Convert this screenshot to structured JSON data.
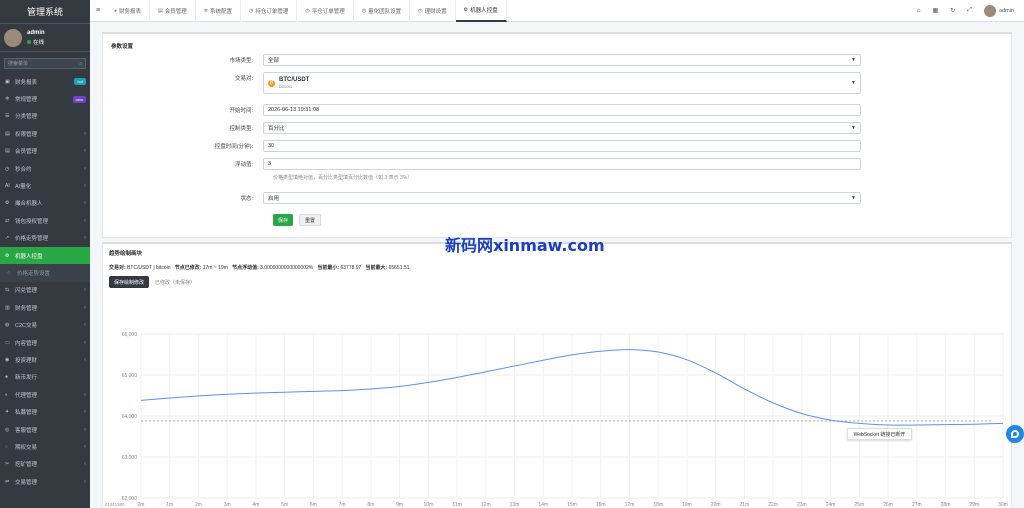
{
  "sidebar": {
    "brand": "管理系统",
    "user": {
      "name": "admin",
      "status": "在线"
    },
    "search_placeholder": "搜索菜单",
    "items": [
      {
        "label": "财务报表",
        "icon": "chart-icon",
        "badge": "hot"
      },
      {
        "label": "常规管理",
        "icon": "gear-icon",
        "badge": "new"
      },
      {
        "label": "分类管理",
        "icon": "list-icon"
      },
      {
        "label": "权限管理",
        "icon": "group-icon",
        "arrow": true
      },
      {
        "label": "会员管理",
        "icon": "user-icon",
        "arrow": true
      },
      {
        "label": "秒合约",
        "icon": "clock-icon",
        "arrow": true
      },
      {
        "label": "AI量化",
        "icon": "ai-icon",
        "arrow": true
      },
      {
        "label": "撮合机器人",
        "icon": "robot-icon",
        "arrow": true
      },
      {
        "label": "钱包授权管理",
        "icon": "transfer-icon",
        "arrow": true
      },
      {
        "label": "价格走势管理",
        "icon": "trend-icon",
        "arrow": true
      },
      {
        "label": "机器人控盘",
        "icon": "robot-icon",
        "active": true
      },
      {
        "label": "价格走势设置",
        "icon": "dot-icon",
        "sub": true
      },
      {
        "label": "闪兑管理",
        "icon": "exchange-icon",
        "arrow": true
      },
      {
        "label": "财务管理",
        "icon": "money-icon",
        "arrow": true
      },
      {
        "label": "C2C交易",
        "icon": "c2c-icon",
        "arrow": true
      },
      {
        "label": "内容管理",
        "icon": "folder-icon",
        "arrow": true
      },
      {
        "label": "投资理财",
        "icon": "invest-icon",
        "arrow": true
      },
      {
        "label": "新币发行",
        "icon": "coin-icon"
      },
      {
        "label": "代理管理",
        "icon": "agent-icon",
        "arrow": true
      },
      {
        "label": "私募管理",
        "icon": "private-icon",
        "arrow": true
      },
      {
        "label": "客服管理",
        "icon": "chat-icon",
        "arrow": true
      },
      {
        "label": "期权交易",
        "icon": "option-icon",
        "arrow": true
      },
      {
        "label": "挖矿管理",
        "icon": "mining-icon",
        "arrow": true
      },
      {
        "label": "交易管理",
        "icon": "trade-icon",
        "arrow": true
      }
    ]
  },
  "topbar": {
    "tabs": [
      {
        "label": "财务报表",
        "icon": "dashboard-icon"
      },
      {
        "label": "会员管理",
        "icon": "user-icon"
      },
      {
        "label": "系统配置",
        "icon": "gear-icon"
      },
      {
        "label": "持仓订单管理",
        "icon": "clock-icon"
      },
      {
        "label": "平仓订单管理",
        "icon": "clock-icon"
      },
      {
        "label": "量化团队设置",
        "icon": "clock-icon"
      },
      {
        "label": "理财设置",
        "icon": "clock-icon"
      },
      {
        "label": "机器人控盘",
        "icon": "robot-icon",
        "active": true
      }
    ],
    "admin": "admin"
  },
  "form": {
    "title": "参数设置",
    "market_type": {
      "label": "市场类型:",
      "value": "全部"
    },
    "pair": {
      "label": "交易对:",
      "title": "BTC/USDT",
      "sub": "bitcoin"
    },
    "start_time": {
      "label": "开始时间:",
      "value": "2026-06-13 19:31:08"
    },
    "control_type": {
      "label": "控制类型:",
      "value": "百分比"
    },
    "duration": {
      "label": "控盘时间(分钟):",
      "value": "30"
    },
    "float_value": {
      "label": "浮动值:",
      "value": "3",
      "help": "价格类型填绝对值，百分比类型填百分比数值（如 3 表示 3%）"
    },
    "status": {
      "label": "状态:",
      "value": "启用"
    },
    "save_label": "保存",
    "reset_label": "重置"
  },
  "trend": {
    "title": "趋势绘制画块",
    "info": {
      "pair_label": "交易对:",
      "pair_value": "BTC/USDT | bitcoin",
      "node_label": "节点已修改:",
      "node_value": "17m ~ 19m",
      "float_label": "节点浮动值:",
      "float_value": "3.0000000000000002%",
      "min_label": "当前最小:",
      "min_value": "63778.97",
      "max_label": "当前最大:",
      "max_value": "65651.51"
    },
    "save_button": "保存绘制修改",
    "save_note": "已修改（未保存）"
  },
  "chart_data": {
    "type": "line",
    "x": [
      "0m",
      "1m",
      "2m",
      "3m",
      "4m",
      "5m",
      "6m",
      "7m",
      "8m",
      "9m",
      "10m",
      "11m",
      "12m",
      "13m",
      "14m",
      "15m",
      "16m",
      "17m",
      "18m",
      "19m",
      "20m",
      "21m",
      "22m",
      "23m",
      "24m",
      "25m",
      "26m",
      "27m",
      "28m",
      "29m",
      "30m"
    ],
    "series": [
      {
        "values": [
          64380,
          64440,
          64490,
          64530,
          64560,
          64580,
          64600,
          64620,
          64660,
          64720,
          64820,
          64940,
          65080,
          65220,
          65360,
          65490,
          65580,
          65620,
          65560,
          65370,
          65050,
          64660,
          64320,
          64060,
          63900,
          63820,
          63780,
          63780,
          63790,
          63800,
          63820
        ]
      }
    ],
    "reference_line": 63880,
    "ylim": [
      62000,
      66000
    ],
    "y_ticks": [
      "66,000",
      "65,000",
      "64,000",
      "63,000",
      "62,000"
    ],
    "y_bottom_label": "61911586",
    "line_color": "#5b8ff9",
    "grid": true
  },
  "websocket": {
    "label": "WebSocket 链接已断开"
  },
  "watermark": "新码网xinmaw.com"
}
